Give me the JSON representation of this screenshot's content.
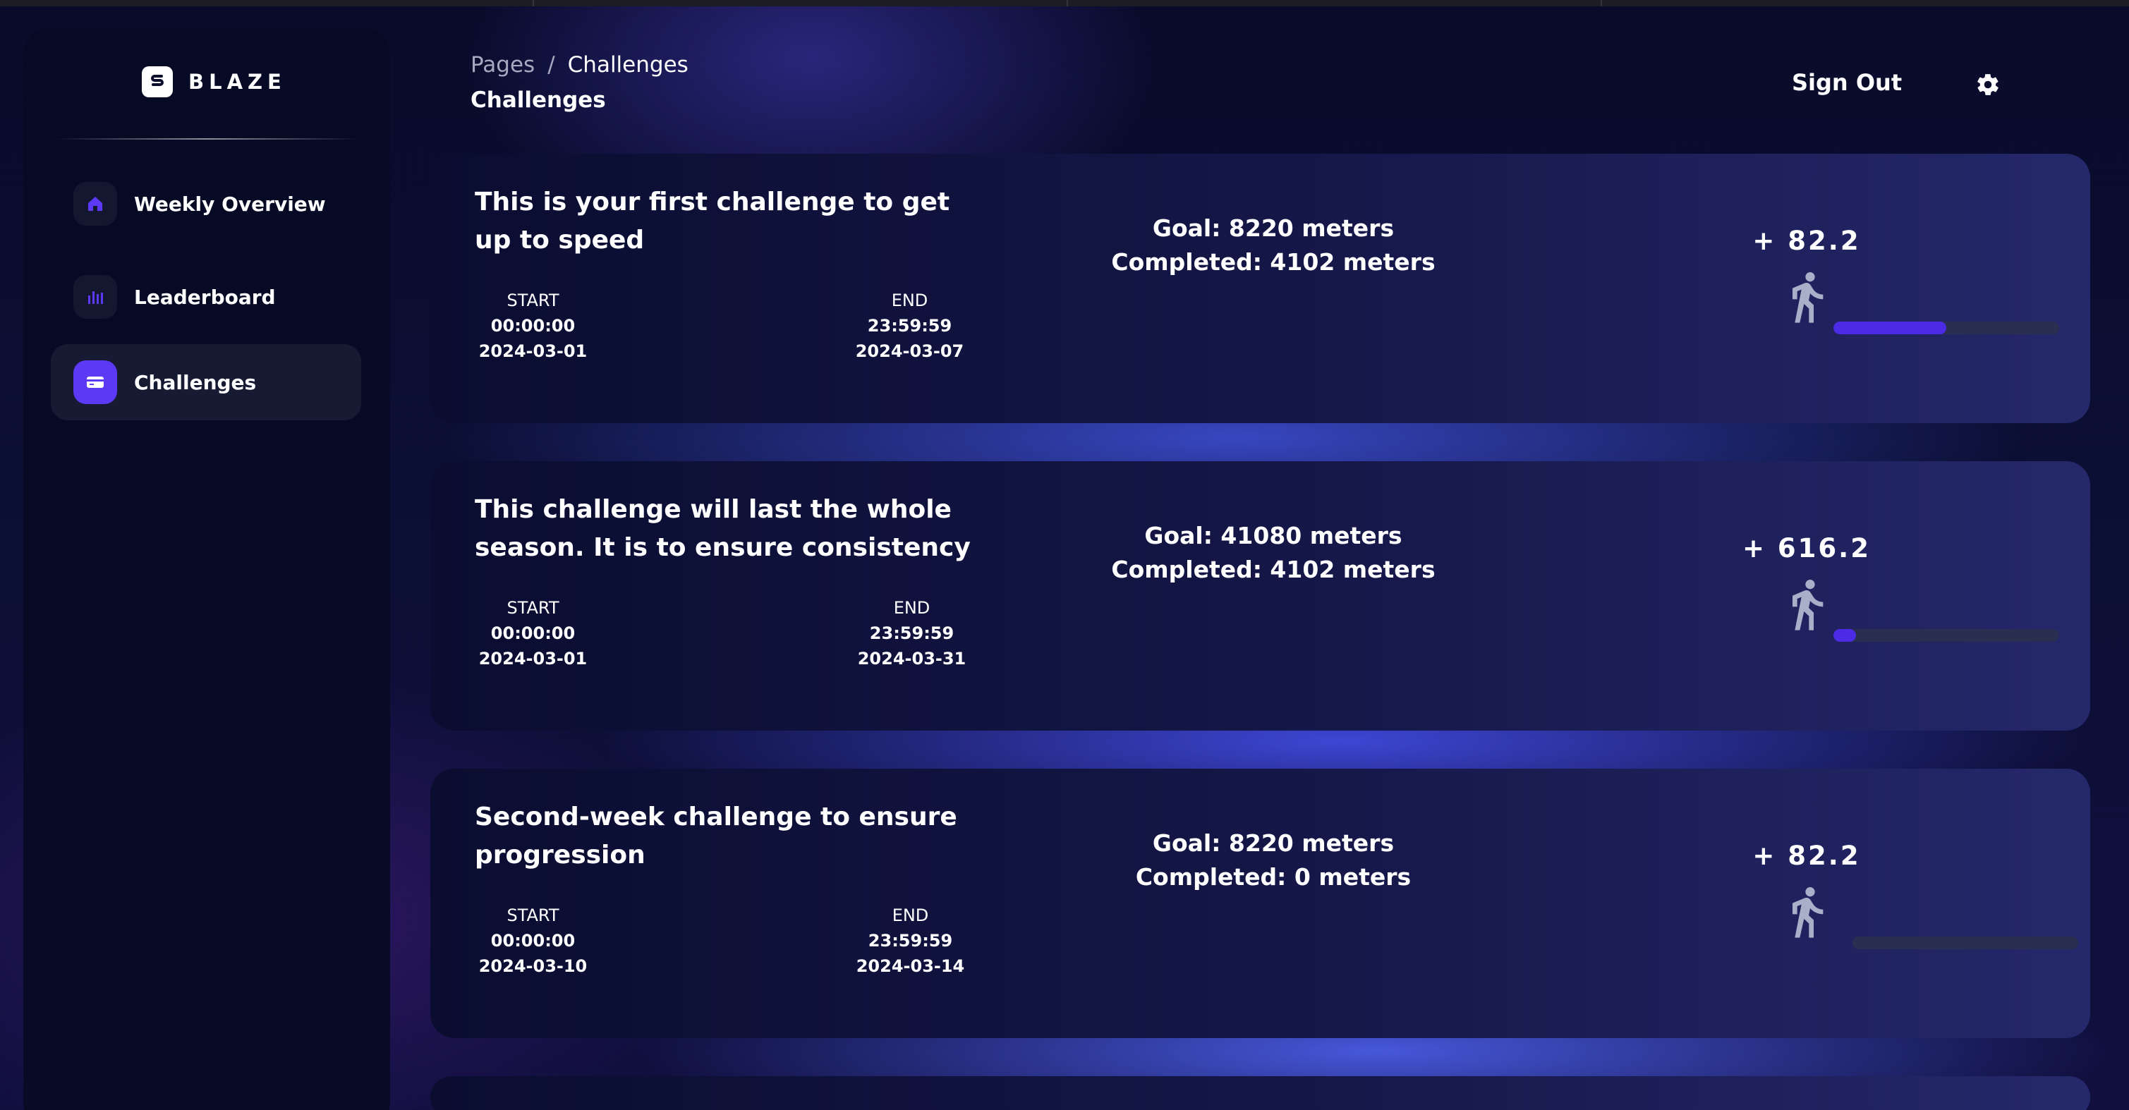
{
  "brand": {
    "name": "BLAZE",
    "logo_icon": "bolt-s-icon"
  },
  "sidebar": {
    "items": [
      {
        "label": "Weekly Overview",
        "icon": "home-icon",
        "active": false
      },
      {
        "label": "Leaderboard",
        "icon": "bar-chart-icon",
        "active": false
      },
      {
        "label": "Challenges",
        "icon": "card-icon",
        "active": true
      }
    ]
  },
  "header": {
    "breadcrumb_root": "Pages",
    "breadcrumb_separator": "/",
    "breadcrumb_current": "Challenges",
    "title": "Challenges",
    "sign_out": "Sign Out",
    "settings_icon": "gear-icon"
  },
  "colors": {
    "accent": "#5b39f5",
    "progress_fill": "#4b2be6",
    "progress_track": "#2a2f52",
    "runner_icon": "#a9aec9"
  },
  "challenges": [
    {
      "title": "This is your first challenge to get up to speed",
      "start_label": "START",
      "start_time": "00:00:00",
      "start_date": "2024-03-01",
      "end_label": "END",
      "end_time": "23:59:59",
      "end_date": "2024-03-07",
      "goal": "Goal: 8220 meters",
      "completed": "Completed: 4102 meters",
      "progress": 0.5,
      "reward": "+ 82.2"
    },
    {
      "title": "This challenge will last the whole season. It is to ensure consistency",
      "start_label": "START",
      "start_time": "00:00:00",
      "start_date": "2024-03-01",
      "end_label": "END",
      "end_time": "23:59:59",
      "end_date": "2024-03-31",
      "goal": "Goal: 41080 meters",
      "completed": "Completed: 4102 meters",
      "progress": 0.1,
      "reward": "+ 616.2"
    },
    {
      "title": "Second-week challenge to ensure progression",
      "start_label": "START",
      "start_time": "00:00:00",
      "start_date": "2024-03-10",
      "end_label": "END",
      "end_time": "23:59:59",
      "end_date": "2024-03-14",
      "goal": "Goal: 8220 meters",
      "completed": "Completed: 0 meters",
      "progress": 0,
      "reward": "+ 82.2"
    }
  ]
}
